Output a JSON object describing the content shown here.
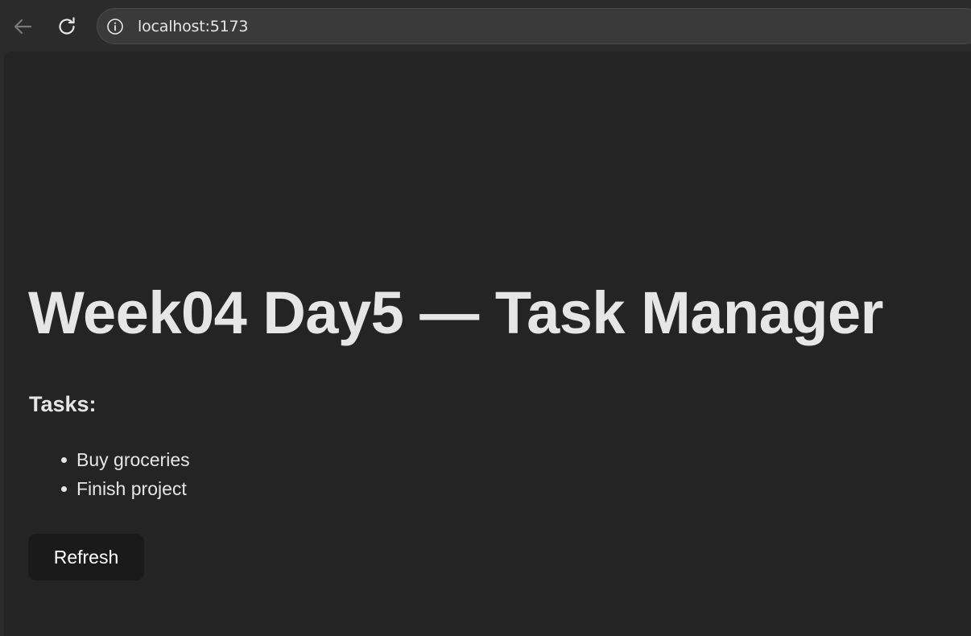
{
  "browser": {
    "url": "localhost:5173",
    "back_icon": "arrow-left-icon",
    "reload_icon": "reload-icon",
    "info_icon": "info-circle-icon"
  },
  "page": {
    "title": "Week04 Day5 — Task Manager",
    "tasks_heading": "Tasks:",
    "tasks": [
      {
        "label": "Buy groceries"
      },
      {
        "label": "Finish project"
      }
    ],
    "refresh_label": "Refresh"
  },
  "colors": {
    "toolbar_bg": "#2b2b2b",
    "page_bg": "#242424",
    "text": "#e6e6e6",
    "button_bg": "#1a1a1a"
  }
}
